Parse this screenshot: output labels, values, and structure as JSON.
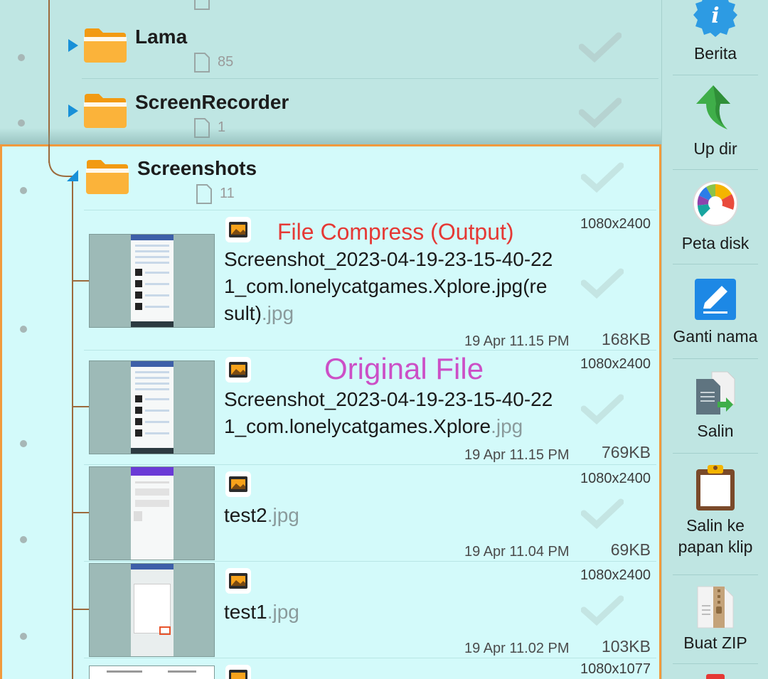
{
  "folders": [
    {
      "name": "Lama",
      "count": "85"
    },
    {
      "name": "ScreenRecorder",
      "count": "1"
    },
    {
      "name": "Screenshots",
      "count": "11"
    }
  ],
  "files": [
    {
      "name": "Screenshot_2023-04-19-23-15-40-22\n1_com.lonelycatgames.Xplore.jpg(re\nsult)",
      "ext": ".jpg",
      "resolution": "1080x2400",
      "date": "19 Apr 11.15 PM",
      "size": "168KB"
    },
    {
      "name": "Screenshot_2023-04-19-23-15-40-22\n1_com.lonelycatgames.Xplore",
      "ext": ".jpg",
      "resolution": "1080x2400",
      "date": "19 Apr 11.15 PM",
      "size": "769KB"
    },
    {
      "name": "test2",
      "ext": ".jpg",
      "resolution": "1080x2400",
      "date": "19 Apr 11.04 PM",
      "size": "69KB"
    },
    {
      "name": "test1",
      "ext": ".jpg",
      "resolution": "1080x2400",
      "date": "19 Apr 11.02 PM",
      "size": "103KB"
    },
    {
      "name": "",
      "ext": "",
      "resolution": "1080x1077",
      "date": "",
      "size": ""
    }
  ],
  "annotations": {
    "compress": {
      "text": "File Compress (Output)",
      "color": "#e53935"
    },
    "original": {
      "text": "Original File",
      "color": "#cc4fc6"
    }
  },
  "actions": [
    {
      "label": "Berita",
      "icon": "info-badge-icon"
    },
    {
      "label": "Up dir",
      "icon": "up-arrow-icon"
    },
    {
      "label": "Peta disk",
      "icon": "disk-map-icon"
    },
    {
      "label": "Ganti nama",
      "icon": "rename-pencil-icon"
    },
    {
      "label": "Salin",
      "icon": "copy-document-icon"
    },
    {
      "label": "Salin ke\npapan klip",
      "icon": "clipboard-icon"
    },
    {
      "label": "Buat ZIP",
      "icon": "zip-file-icon"
    }
  ],
  "colors": {
    "selected_border": "#f19a3c",
    "expand_arrow": "#1890d8",
    "folder": "#f8a728"
  }
}
